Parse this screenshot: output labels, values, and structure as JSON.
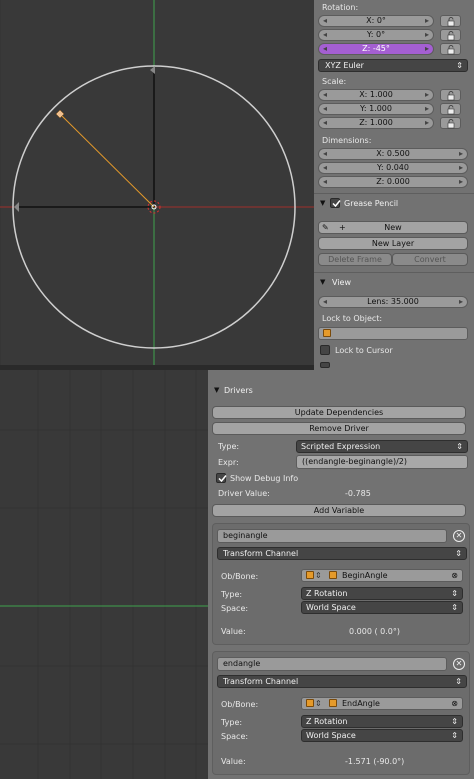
{
  "transform": {
    "rotation_label": "Rotation:",
    "rot_x": "X: 0°",
    "rot_y": "Y: 0°",
    "rot_z": "Z: -45°",
    "rotation_mode": "XYZ Euler",
    "scale_label": "Scale:",
    "scale_x": "X: 1.000",
    "scale_y": "Y: 1.000",
    "scale_z": "Z: 1.000",
    "dimensions_label": "Dimensions:",
    "dim_x": "X: 0.500",
    "dim_y": "Y: 0.040",
    "dim_z": "Z: 0.000"
  },
  "grease_pencil": {
    "title": "Grease Pencil",
    "new_label": "New",
    "new_layer_label": "New Layer",
    "delete_frame_label": "Delete Frame",
    "convert_label": "Convert"
  },
  "view": {
    "title": "View",
    "lens": "Lens: 35.000",
    "lock_to_object_label": "Lock to Object:",
    "lock_to_cursor_label": "Lock to Cursor"
  },
  "drivers": {
    "title": "Drivers",
    "update_dependencies_label": "Update Dependencies",
    "remove_driver_label": "Remove Driver",
    "type_label": "Type:",
    "type_value": "Scripted Expression",
    "expr_label": "Expr:",
    "expr_value": "((endangle-beginangle)/2)",
    "show_debug_label": "Show Debug Info",
    "driver_value_label": "Driver Value:",
    "driver_value": "-0.785",
    "add_variable_label": "Add Variable",
    "variables": [
      {
        "name": "beginangle",
        "kind": "Transform Channel",
        "ob_bone_label": "Ob/Bone:",
        "object": "BeginAngle",
        "type_label": "Type:",
        "type_value": "Z Rotation",
        "space_label": "Space:",
        "space_value": "World Space",
        "value_label": "Value:",
        "value": "0.000 ( 0.0°)"
      },
      {
        "name": "endangle",
        "kind": "Transform Channel",
        "ob_bone_label": "Ob/Bone:",
        "object": "EndAngle",
        "type_label": "Type:",
        "type_value": "Z Rotation",
        "space_label": "Space:",
        "space_value": "World Space",
        "value_label": "Value:",
        "value": "-1.571 (-90.0°)"
      }
    ]
  },
  "colors": {
    "panel_bg": "#727272",
    "viewport_bg": "#393939",
    "selected_field": "#a45fd2",
    "axis_red": "#c0392b",
    "axis_green": "#3fa34d",
    "object_orange": "#e59a2a"
  }
}
